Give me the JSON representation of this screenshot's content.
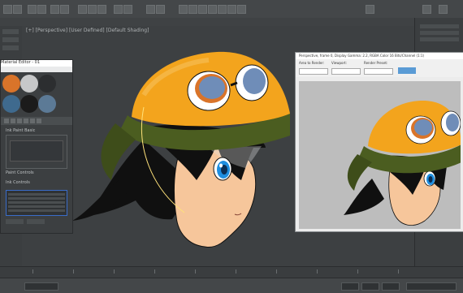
{
  "app": {
    "viewport_label": "[+] [Perspective] [User Defined] [Default Shading]"
  },
  "material_editor": {
    "title": "Material Editor - 01",
    "group_labels": [
      "Ink Paint Basic",
      "Paint Controls",
      "Ink Controls"
    ],
    "swatch_colors": [
      "#d9742a",
      "#c7c8c9",
      "#2c2e30",
      "#3f6a8e",
      "#b8b8b8",
      "#1b1b1b",
      "#5c7a96",
      "#9aa0a4"
    ]
  },
  "render_window": {
    "title": "Perspective, frame 0, Display Gamma: 2.2, RGBA Color 16 Bits/Channel (1:1)",
    "labels": [
      "Area to Render:",
      "Viewport:",
      "Render Preset:"
    ]
  },
  "colors": {
    "helmet": "#f3a41d",
    "helmet_band": "#4b5d20",
    "skin": "#f6c69b",
    "hair": "#101010",
    "eye": "#1e8ee0",
    "goggle_lens": "#6f8db8",
    "render_bg": "#bdbdbd"
  }
}
